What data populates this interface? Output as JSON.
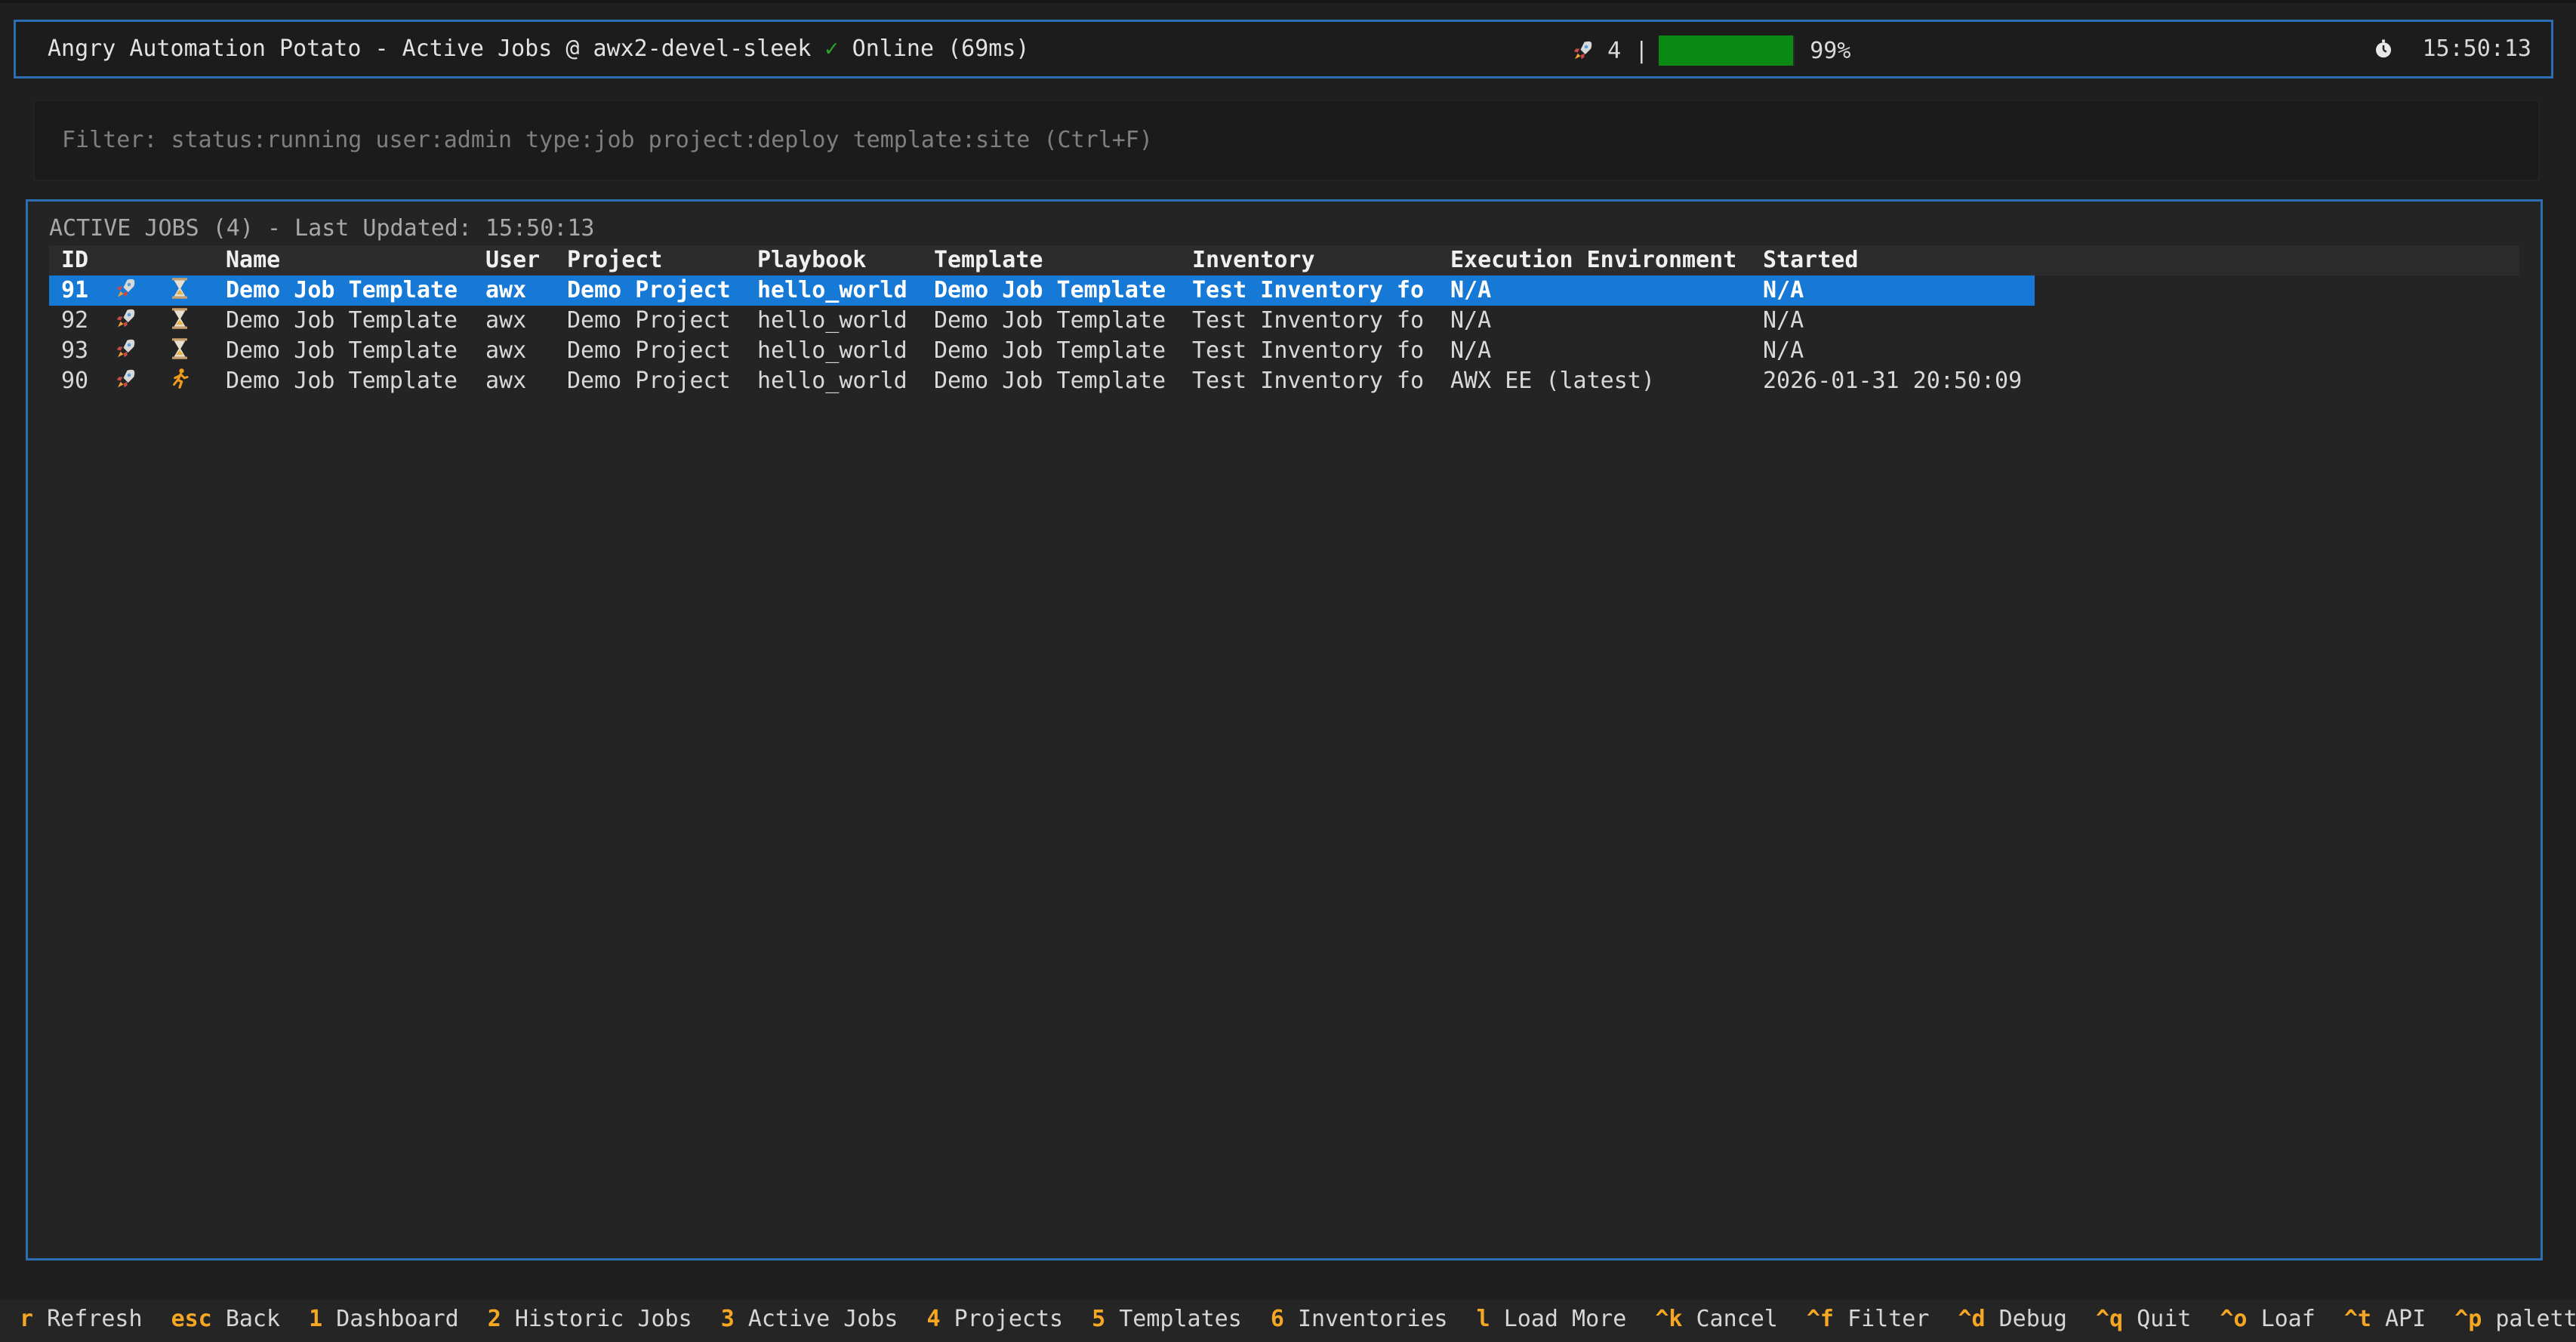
{
  "header": {
    "title": "Angry Automation Potato - Active Jobs @ awx2-devel-sleek",
    "check_glyph": "✓",
    "status": "Online (69ms)",
    "job_count": "4",
    "separator": "|",
    "capacity_fraction": 0.99,
    "capacity_label": "99%",
    "time": "15:50:13",
    "colors": {
      "border": "#2d6db1",
      "progress": "#0a8a12",
      "online": "#2aa52a"
    }
  },
  "filter": {
    "text": "Filter: status:running user:admin type:job project:deploy template:site (Ctrl+F)"
  },
  "panel": {
    "title": "ACTIVE JOBS (4) - Last Updated: 15:50:13"
  },
  "table": {
    "headers": {
      "id": "ID",
      "name": "Name",
      "user": "User",
      "project": "Project",
      "playbook": "Playbook",
      "template": "Template",
      "inventory": "Inventory",
      "ee": "Execution Environment",
      "started": "Started"
    },
    "rows": [
      {
        "id": "91",
        "type_icon": "rocket-icon",
        "status_icon": "hourglass-icon",
        "name": "Demo Job Template",
        "user": "awx",
        "project": "Demo Project",
        "playbook": "hello_world",
        "template": "Demo Job Template",
        "inventory": "Test Inventory fo",
        "ee": "N/A",
        "started": "N/A",
        "selected": true
      },
      {
        "id": "92",
        "type_icon": "rocket-icon",
        "status_icon": "hourglass-icon",
        "name": "Demo Job Template",
        "user": "awx",
        "project": "Demo Project",
        "playbook": "hello_world",
        "template": "Demo Job Template",
        "inventory": "Test Inventory fo",
        "ee": "N/A",
        "started": "N/A",
        "selected": false
      },
      {
        "id": "93",
        "type_icon": "rocket-icon",
        "status_icon": "hourglass-icon",
        "name": "Demo Job Template",
        "user": "awx",
        "project": "Demo Project",
        "playbook": "hello_world",
        "template": "Demo Job Template",
        "inventory": "Test Inventory fo",
        "ee": "N/A",
        "started": "N/A",
        "selected": false
      },
      {
        "id": "90",
        "type_icon": "rocket-icon",
        "status_icon": "running-icon",
        "name": "Demo Job Template",
        "user": "awx",
        "project": "Demo Project",
        "playbook": "hello_world",
        "template": "Demo Job Template",
        "inventory": "Test Inventory fo",
        "ee": "AWX EE (latest)",
        "started": "2026-01-31 20:50:09",
        "selected": false
      }
    ],
    "colors": {
      "selected_bg": "#1679d6"
    }
  },
  "footer": {
    "bindings": [
      {
        "key": "r",
        "label": "Refresh"
      },
      {
        "key": "esc",
        "label": "Back"
      },
      {
        "key": "1",
        "label": "Dashboard"
      },
      {
        "key": "2",
        "label": "Historic Jobs"
      },
      {
        "key": "3",
        "label": "Active Jobs"
      },
      {
        "key": "4",
        "label": "Projects"
      },
      {
        "key": "5",
        "label": "Templates"
      },
      {
        "key": "6",
        "label": "Inventories"
      },
      {
        "key": "l",
        "label": "Load More"
      },
      {
        "key": "^k",
        "label": "Cancel"
      },
      {
        "key": "^f",
        "label": "Filter"
      },
      {
        "key": "^d",
        "label": "Debug"
      },
      {
        "key": "^q",
        "label": "Quit"
      },
      {
        "key": "^o",
        "label": "Loaf"
      },
      {
        "key": "^t",
        "label": "API"
      },
      {
        "key": "^p",
        "label": "palette"
      }
    ],
    "colors": {
      "key": "#f5a623"
    }
  }
}
